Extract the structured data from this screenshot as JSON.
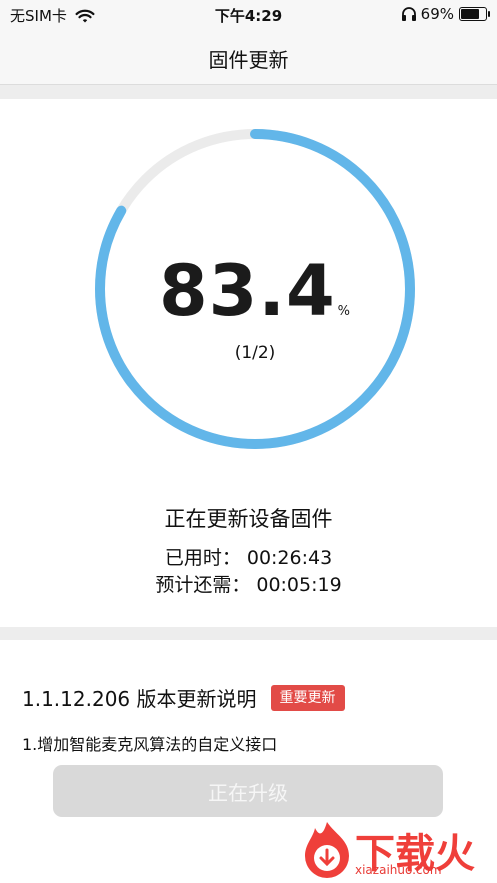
{
  "status_bar": {
    "carrier": "无SIM卡",
    "time": "下午4:29",
    "battery": "69%",
    "battery_level": 0.69,
    "icons": [
      "wifi-icon",
      "headphone-icon",
      "battery-icon"
    ]
  },
  "nav": {
    "title": "固件更新"
  },
  "progress": {
    "value": "83.4",
    "value_fraction": 0.834,
    "unit": "%",
    "step": "(1/2)",
    "ring_color": "#62b6e9",
    "track_color": "#ebebeb"
  },
  "status": {
    "text": "正在更新设备固件",
    "elapsed": "已用时： 00:26:43",
    "remaining": "预计还需： 00:05:19"
  },
  "release": {
    "title": "1.1.12.206 版本更新说明",
    "badge": "重要更新",
    "badge_color": "#e24b47",
    "note": "1.增加智能麦克风算法的自定义接口"
  },
  "action": {
    "label": "正在升级"
  },
  "watermark": {
    "text": "下载火",
    "url": "xiazaihuo.com",
    "color": "#ef3f3a"
  }
}
